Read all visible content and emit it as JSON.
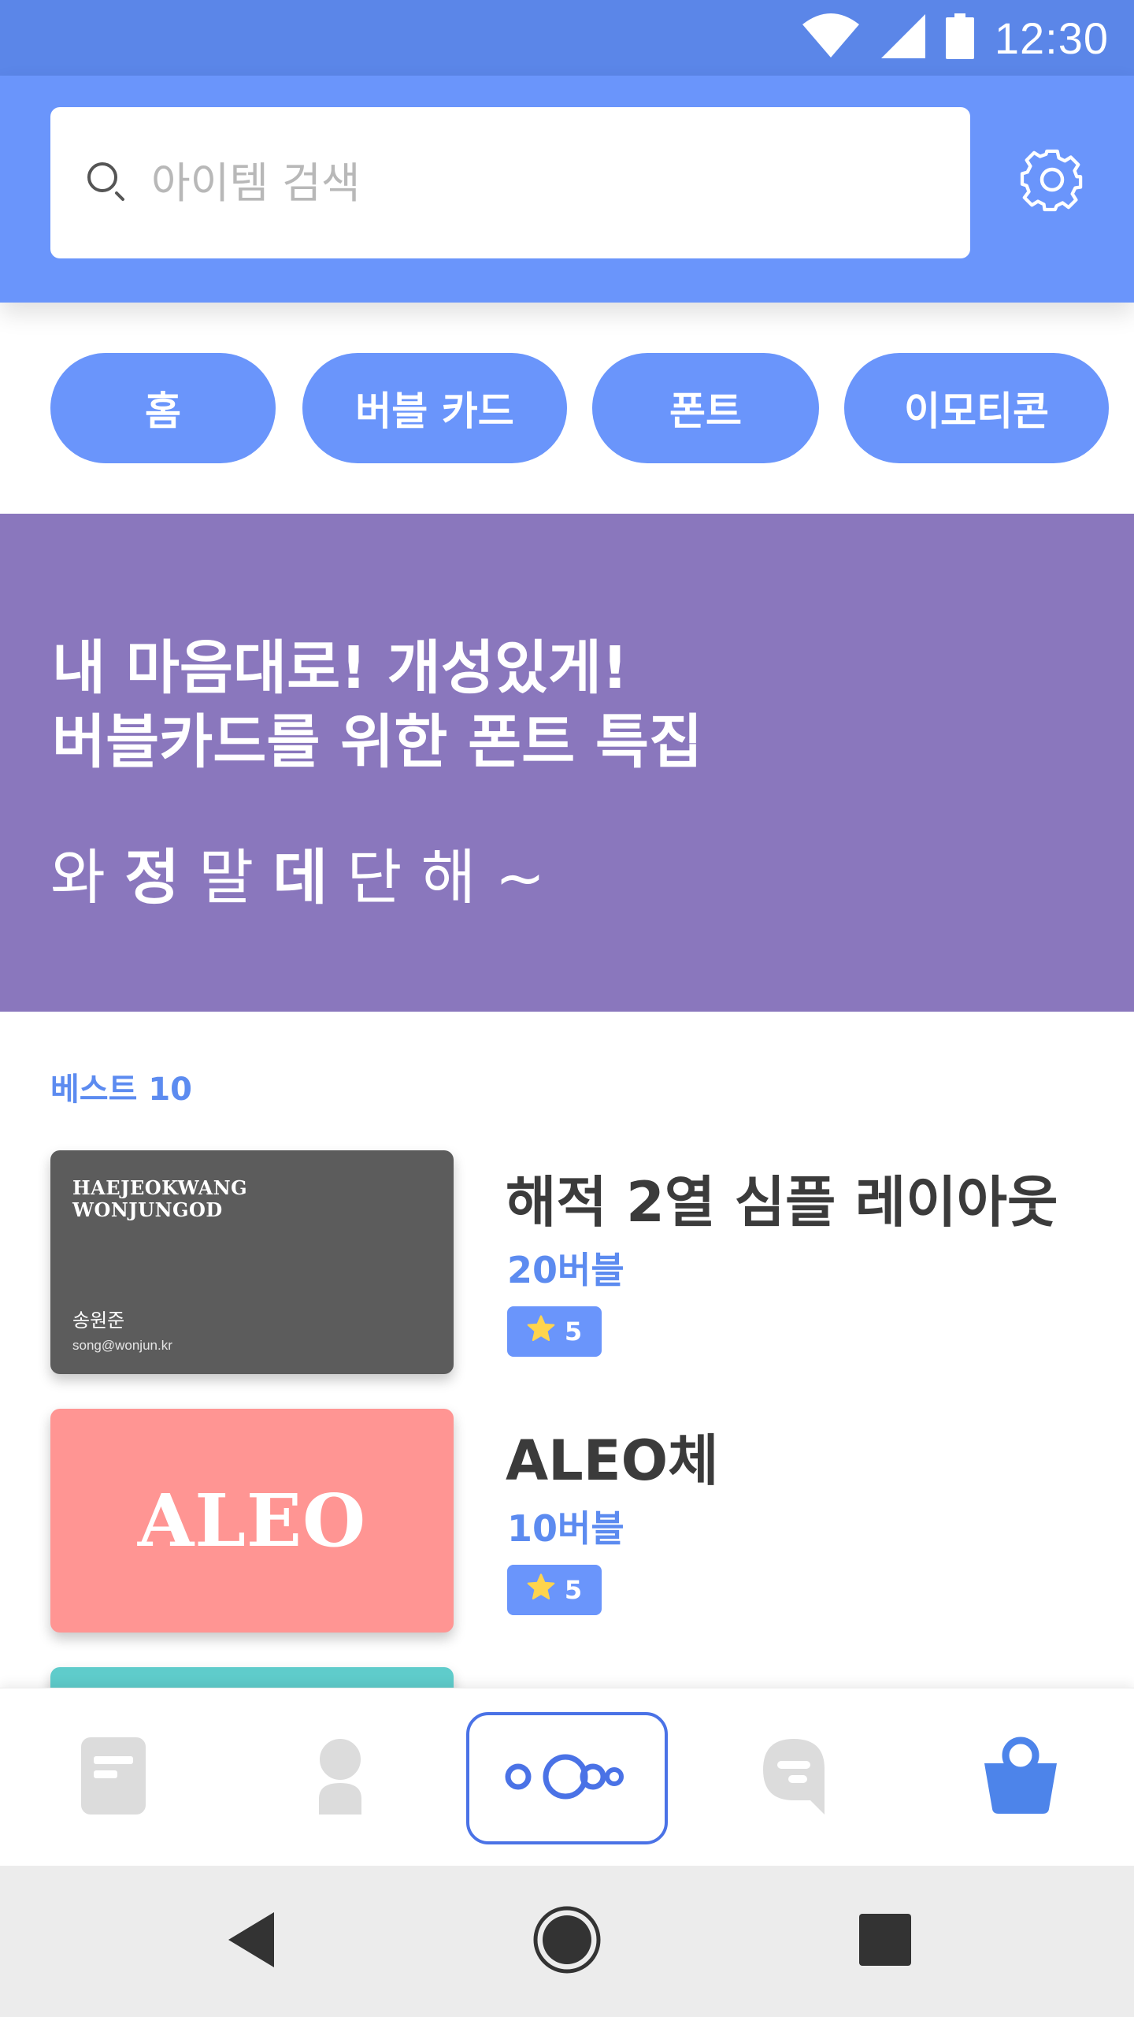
{
  "status_bar": {
    "time": "12:30",
    "icons": [
      "wifi-icon",
      "cell-signal-icon",
      "battery-icon"
    ]
  },
  "search": {
    "placeholder": "아이템 검색",
    "value": ""
  },
  "settings": {
    "icon": "gear-icon"
  },
  "categories": [
    "홈",
    "버블 카드",
    "폰트",
    "이모티콘"
  ],
  "banner": {
    "line1": "내 마음대로! 개성있게!",
    "line2": "버블카드를 위한 폰트 특집",
    "sub": [
      "와",
      "정",
      "말",
      "데",
      "단",
      "해",
      "~"
    ]
  },
  "best": {
    "title": "베스트 10",
    "items": [
      {
        "title": "해적 2열 심플 레이아웃",
        "price": "20버블",
        "rating": "5",
        "thumb_lines": [
          "HAEJEOKWANG",
          "WONJUNGOD"
        ],
        "thumb_name": "송원준",
        "thumb_email": "song@wonjun.kr"
      },
      {
        "title": "ALEO체",
        "price": "10버블",
        "rating": "5",
        "thumb_text": "ALEO"
      }
    ]
  },
  "bottom_nav": [
    "document-icon",
    "profile-icon",
    "bubble-icon",
    "chat-icon",
    "shopping-bag-icon"
  ],
  "colors": {
    "primary": "#6a95fb",
    "status_bar": "#5b86e8",
    "banner": "#8a77bd",
    "accent_text": "#5c8bf0",
    "star": "#ffd44d",
    "thumb_pink": "#ff9593",
    "thumb_dark": "#5c5c5c",
    "thumb_teal": "#5fcccb"
  }
}
